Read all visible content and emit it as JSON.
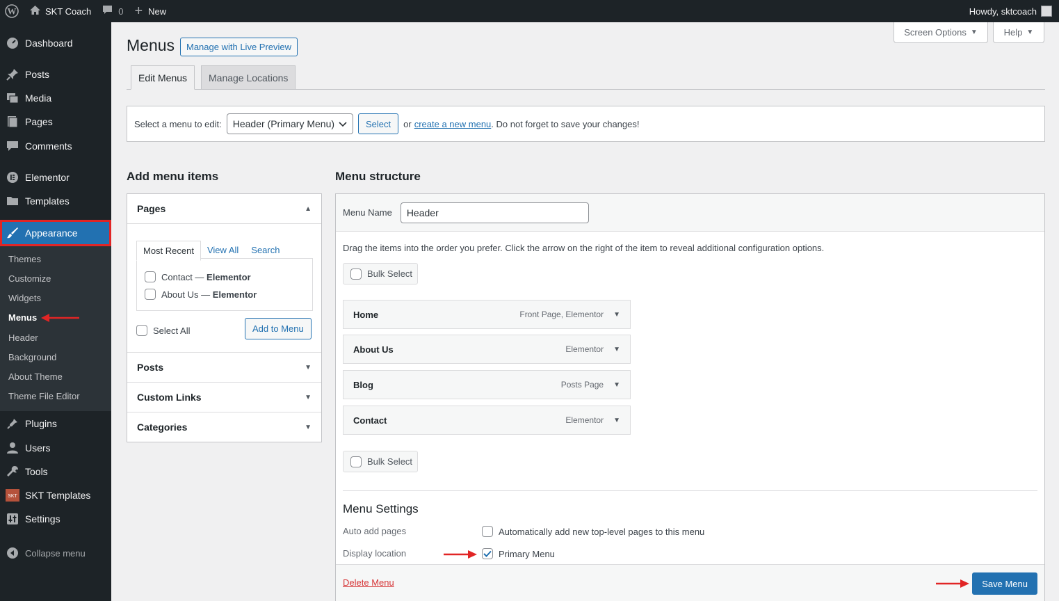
{
  "adminbar": {
    "site_name": "SKT Coach",
    "comments_count": "0",
    "new_label": "New",
    "howdy": "Howdy, sktcoach"
  },
  "sidebar": {
    "items": [
      {
        "label": "Dashboard",
        "icon": "dashboard-icon"
      },
      {
        "label": "Posts",
        "icon": "pin-icon"
      },
      {
        "label": "Media",
        "icon": "media-icon"
      },
      {
        "label": "Pages",
        "icon": "page-icon"
      },
      {
        "label": "Comments",
        "icon": "comment-icon"
      },
      {
        "label": "Elementor",
        "icon": "elementor-icon"
      },
      {
        "label": "Templates",
        "icon": "folder-icon"
      },
      {
        "label": "Appearance",
        "icon": "brush-icon"
      },
      {
        "label": "Plugins",
        "icon": "plugin-icon"
      },
      {
        "label": "Users",
        "icon": "user-icon"
      },
      {
        "label": "Tools",
        "icon": "wrench-icon"
      },
      {
        "label": "SKT Templates",
        "icon": "skt-icon"
      },
      {
        "label": "Settings",
        "icon": "settings-icon"
      }
    ],
    "submenu": [
      "Themes",
      "Customize",
      "Widgets",
      "Menus",
      "Header",
      "Background",
      "About Theme",
      "Theme File Editor"
    ],
    "collapse_label": "Collapse menu"
  },
  "header": {
    "screen_options": "Screen Options",
    "help": "Help",
    "title": "Menus",
    "live_preview": "Manage with Live Preview",
    "tabs": [
      "Edit Menus",
      "Manage Locations"
    ]
  },
  "select_menu": {
    "label": "Select a menu to edit:",
    "selected": "Header (Primary Menu)",
    "select_button": "Select",
    "or": "or",
    "create_link": "create a new menu",
    "suffix": ". Do not forget to save your changes!"
  },
  "add_items": {
    "heading": "Add menu items",
    "pages_title": "Pages",
    "inner_tabs": [
      "Most Recent",
      "View All",
      "Search"
    ],
    "pages": [
      {
        "title": "Contact",
        "sep": " — ",
        "builder": "Elementor"
      },
      {
        "title": "About Us",
        "sep": " — ",
        "builder": "Elementor"
      }
    ],
    "select_all": "Select All",
    "add_button": "Add to Menu",
    "sections": [
      "Posts",
      "Custom Links",
      "Categories"
    ]
  },
  "structure": {
    "heading": "Menu structure",
    "name_label": "Menu Name",
    "name_value": "Header",
    "instructions": "Drag the items into the order you prefer. Click the arrow on the right of the item to reveal additional configuration options.",
    "bulk_select": "Bulk Select",
    "items": [
      {
        "title": "Home",
        "meta": "Front Page, Elementor"
      },
      {
        "title": "About Us",
        "meta": "Elementor"
      },
      {
        "title": "Blog",
        "meta": "Posts Page"
      },
      {
        "title": "Contact",
        "meta": "Elementor"
      }
    ],
    "settings_heading": "Menu Settings",
    "auto_add_label": "Auto add pages",
    "auto_add_text": "Automatically add new top-level pages to this menu",
    "display_label": "Display location",
    "primary_menu": "Primary Menu",
    "delete_menu": "Delete Menu",
    "save_menu": "Save Menu"
  },
  "colors": {
    "accent": "#2271b1",
    "highlight_border": "#e12525",
    "sidebar_bg": "#1d2327"
  }
}
